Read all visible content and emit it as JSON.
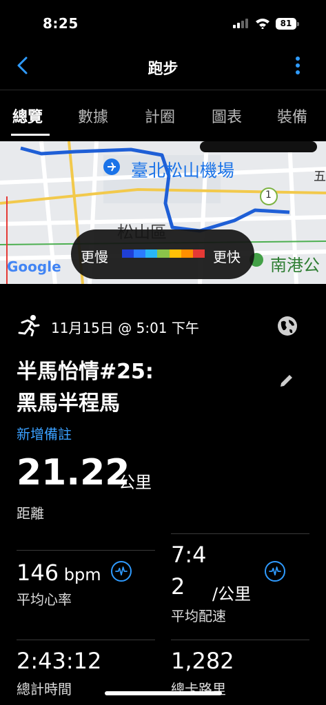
{
  "status_bar": {
    "time": "8:25",
    "battery": "81"
  },
  "nav": {
    "title": "跑步"
  },
  "tabs": [
    "總覽",
    "數據",
    "計圈",
    "圖表",
    "裝備"
  ],
  "map": {
    "labels": {
      "airport": "臺北松山機場",
      "district": "松山區",
      "nangang": "南港公",
      "five": "五",
      "badge": "1",
      "google": "Google"
    },
    "legend": {
      "slower": "更慢",
      "faster": "更快",
      "colors": [
        "#1f3fd6",
        "#2b7bff",
        "#29b6f6",
        "#8bc34a",
        "#ffc107",
        "#ff8f00",
        "#e53935"
      ]
    }
  },
  "activity": {
    "datetime": "11月15日 @ 5:01 下午",
    "title_line1": "半馬怡情#25:",
    "title_line2": "黑馬半程馬",
    "add_note": "新增備註",
    "distance": {
      "value": "21.22",
      "unit": "公里",
      "label": "距離"
    }
  },
  "stats": {
    "heart_rate": {
      "value": "146",
      "unit": "bpm",
      "label": "平均心率"
    },
    "pace": {
      "value_line1": "7:4",
      "value_line2": "2",
      "unit": "/公里",
      "label": "平均配速"
    },
    "time": {
      "value": "2:43:12",
      "label": "總計時間"
    },
    "calories": {
      "value": "1,282",
      "label": "總卡路里"
    }
  },
  "colors": {
    "accent": "#2f9bff",
    "route": "#1f5fd6"
  }
}
